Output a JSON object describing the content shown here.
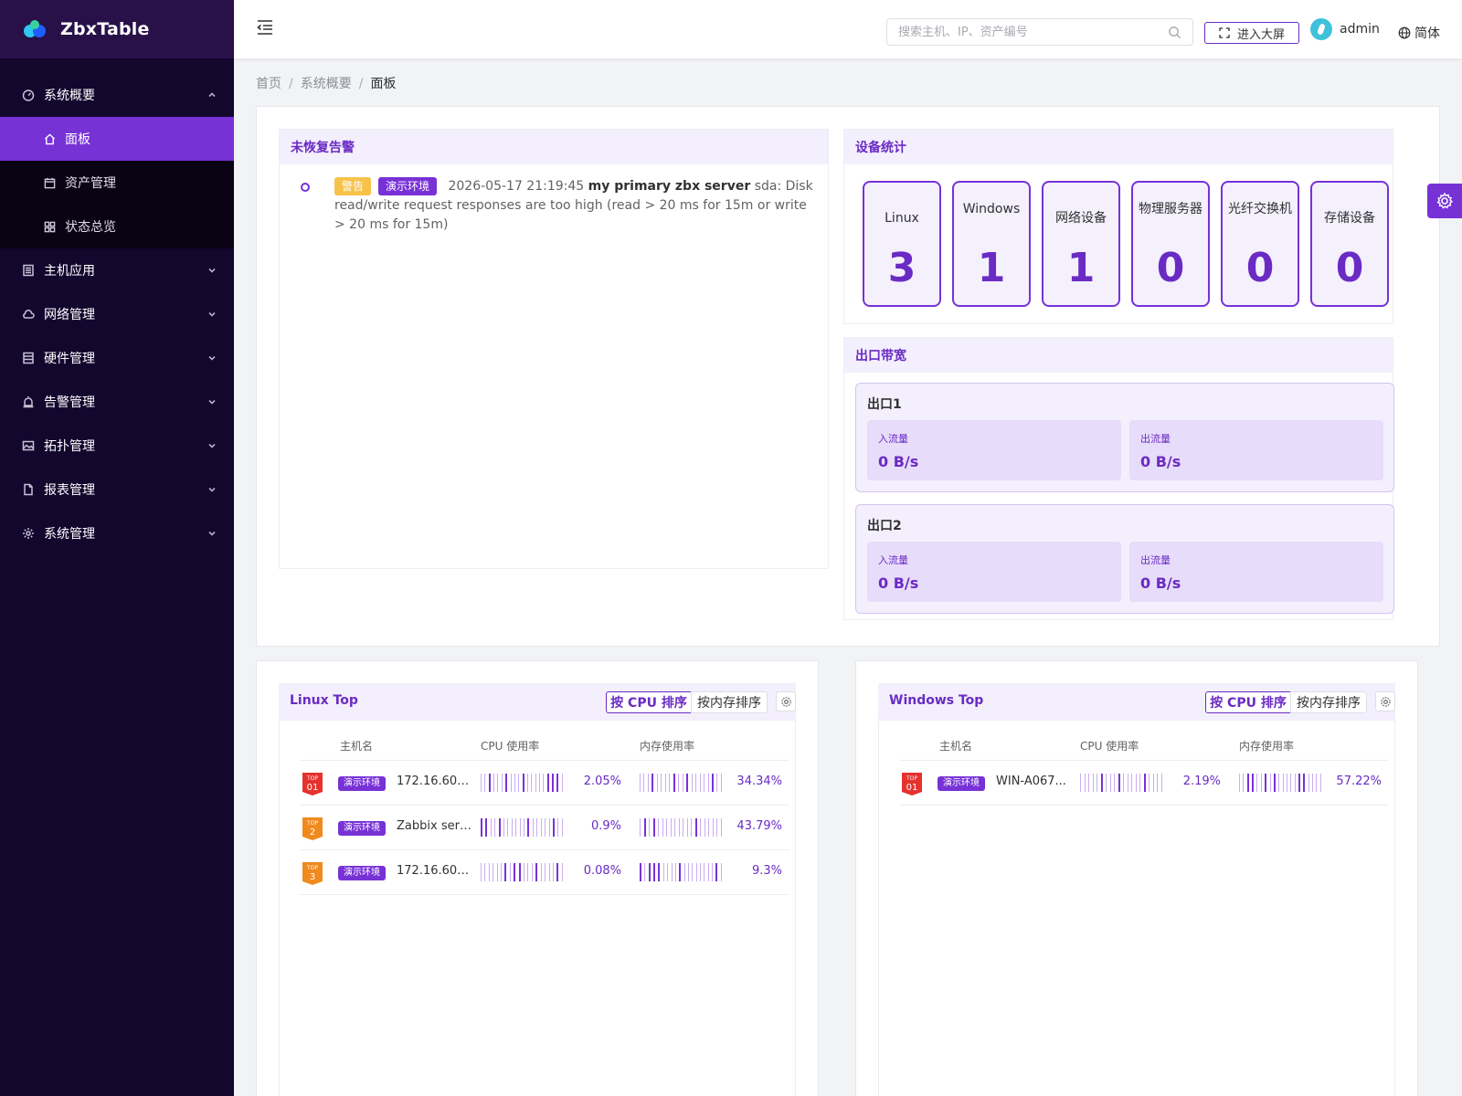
{
  "app": {
    "name": "ZbxTable"
  },
  "sidebar": {
    "groups": [
      {
        "label": "系统概要",
        "icon": "dashboard-icon",
        "expanded": true,
        "children": [
          {
            "label": "面板",
            "icon": "home-icon",
            "active": true
          },
          {
            "label": "资产管理",
            "icon": "calendar-icon"
          },
          {
            "label": "状态总览",
            "icon": "grid-icon"
          }
        ]
      },
      {
        "label": "主机应用",
        "icon": "server-icon"
      },
      {
        "label": "网络管理",
        "icon": "cloud-icon"
      },
      {
        "label": "硬件管理",
        "icon": "storage-icon"
      },
      {
        "label": "告警管理",
        "icon": "alarm-icon"
      },
      {
        "label": "拓扑管理",
        "icon": "image-icon"
      },
      {
        "label": "报表管理",
        "icon": "document-icon"
      },
      {
        "label": "系统管理",
        "icon": "gear-icon"
      }
    ]
  },
  "header": {
    "search_placeholder": "搜索主机、IP、资产编号",
    "bigscreen_label": "进入大屏",
    "user_name": "admin",
    "language": "简体"
  },
  "breadcrumb": [
    "首页",
    "系统概要",
    "面板"
  ],
  "alarms": {
    "title": "未恢复告警",
    "items": [
      {
        "level": "警告",
        "env": "演示环境",
        "time": "2026-05-17 21:19:45",
        "host": "my primary zbx server",
        "message": "sda: Disk read/write request responses are too high (read > 20 ms for 15m or write > 20 ms for 15m)"
      }
    ]
  },
  "devices": {
    "title": "设备统计",
    "items": [
      {
        "name": "Linux",
        "count": "3"
      },
      {
        "name": "Windows",
        "count": "1"
      },
      {
        "name": "网络设备",
        "count": "1"
      },
      {
        "name": "物理服务器",
        "count": "0"
      },
      {
        "name": "光纤交换机",
        "count": "0"
      },
      {
        "name": "存储设备",
        "count": "0"
      }
    ]
  },
  "bandwidth": {
    "title": "出口带宽",
    "outlets": [
      {
        "name": "出口1",
        "in_label": "入流量",
        "in_value": "0 B/s",
        "out_label": "出流量",
        "out_value": "0 B/s"
      },
      {
        "name": "出口2",
        "in_label": "入流量",
        "in_value": "0 B/s",
        "out_label": "出流量",
        "out_value": "0 B/s"
      }
    ]
  },
  "linux_top": {
    "title": "Linux Top",
    "sort_cpu": "按 CPU 排序",
    "sort_mem": "按内存排序",
    "columns": {
      "host": "主机名",
      "cpu": "CPU 使用率",
      "mem": "内存使用率"
    },
    "rows": [
      {
        "rank": "01",
        "env": "演示环境",
        "host": "172.16.60....",
        "cpu": "2.05%",
        "mem": "34.34%"
      },
      {
        "rank": "2",
        "env": "演示环境",
        "host": "Zabbix serv...",
        "cpu": "0.9%",
        "mem": "43.79%"
      },
      {
        "rank": "3",
        "env": "演示环境",
        "host": "172.16.60....",
        "cpu": "0.08%",
        "mem": "9.3%"
      }
    ]
  },
  "windows_top": {
    "title": "Windows Top",
    "sort_cpu": "按 CPU 排序",
    "sort_mem": "按内存排序",
    "columns": {
      "host": "主机名",
      "cpu": "CPU 使用率",
      "mem": "内存使用率"
    },
    "rows": [
      {
        "rank": "01",
        "env": "演示环境",
        "host": "WIN-A067...",
        "cpu": "2.19%",
        "mem": "57.22%"
      }
    ]
  },
  "colors": {
    "accent": "#7732d6",
    "sidebar_bg": "#13072e",
    "warn": "#f7c24a",
    "rank1": "#e5322d",
    "rank23": "#f08a1d"
  }
}
